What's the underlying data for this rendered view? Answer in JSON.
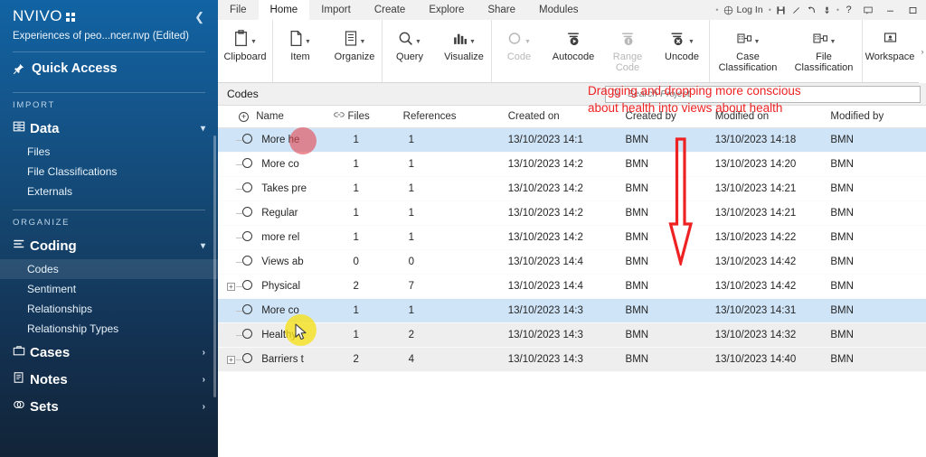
{
  "sidebar": {
    "logo": "NVIVO",
    "collapse_icon": "chevron-left-icon",
    "project_name": "Experiences of peo...ncer.nvp (Edited)",
    "quick_access": {
      "label": "Quick Access",
      "icon": "pin-icon"
    },
    "sections": [
      {
        "label": "IMPORT",
        "groups": [
          {
            "label": "Data",
            "icon": "data-icon",
            "chevron": "chevron-down-icon",
            "expanded": true,
            "items": [
              {
                "label": "Files",
                "active": false
              },
              {
                "label": "File Classifications",
                "active": false
              },
              {
                "label": "Externals",
                "active": false
              }
            ]
          }
        ]
      },
      {
        "label": "ORGANIZE",
        "groups": [
          {
            "label": "Coding",
            "icon": "coding-icon",
            "chevron": "chevron-down-icon",
            "expanded": true,
            "items": [
              {
                "label": "Codes",
                "active": true
              },
              {
                "label": "Sentiment",
                "active": false
              },
              {
                "label": "Relationships",
                "active": false
              },
              {
                "label": "Relationship Types",
                "active": false
              }
            ]
          },
          {
            "label": "Cases",
            "icon": "case-icon",
            "chevron": "chevron-right-icon",
            "expanded": false,
            "items": []
          },
          {
            "label": "Notes",
            "icon": "notes-icon",
            "chevron": "chevron-right-icon",
            "expanded": false,
            "items": []
          },
          {
            "label": "Sets",
            "icon": "sets-icon",
            "chevron": "chevron-right-icon",
            "expanded": false,
            "items": []
          }
        ]
      }
    ]
  },
  "tabbar": {
    "tabs": [
      {
        "label": "File",
        "active": false
      },
      {
        "label": "Home",
        "active": true
      },
      {
        "label": "Import",
        "active": false
      },
      {
        "label": "Create",
        "active": false
      },
      {
        "label": "Explore",
        "active": false
      },
      {
        "label": "Share",
        "active": false
      },
      {
        "label": "Modules",
        "active": false
      }
    ],
    "login_label": "Log In",
    "login_icon": "account-circle-icon",
    "quick_icons": [
      "save-icon",
      "pen-icon",
      "undo-icon",
      "redo-dropdown-icon",
      "dot-icon",
      "help-icon"
    ],
    "comment_icon": "comment-icon",
    "minimize_icon": "minimize-icon",
    "maximize_icon": "maximize-icon"
  },
  "ribbon": {
    "groups": [
      {
        "buttons": [
          {
            "label": "Clipboard",
            "icon": "clipboard-icon",
            "caret": true,
            "disabled": false
          }
        ]
      },
      {
        "buttons": [
          {
            "label": "Item",
            "icon": "item-icon",
            "caret": true,
            "disabled": false
          },
          {
            "label": "Organize",
            "icon": "organize-icon",
            "caret": true,
            "disabled": false
          }
        ]
      },
      {
        "buttons": [
          {
            "label": "Query",
            "icon": "query-icon",
            "caret": true,
            "disabled": false
          },
          {
            "label": "Visualize",
            "icon": "visualize-icon",
            "caret": true,
            "disabled": false
          }
        ]
      },
      {
        "buttons": [
          {
            "label": "Code",
            "icon": "code-icon",
            "caret": true,
            "disabled": true
          },
          {
            "label": "Autocode",
            "icon": "autocode-icon",
            "caret": false,
            "disabled": false
          },
          {
            "label": "Range Code",
            "icon": "range-code-icon",
            "caret": false,
            "disabled": true
          },
          {
            "label": "Uncode",
            "icon": "uncode-icon",
            "caret": true,
            "disabled": false
          }
        ]
      },
      {
        "buttons": [
          {
            "label": "Case Classification",
            "icon": "case-classification-icon",
            "caret": true,
            "disabled": false
          },
          {
            "label": "File Classification",
            "icon": "file-classification-icon",
            "caret": true,
            "disabled": false
          }
        ]
      },
      {
        "buttons": [
          {
            "label": "Workspace",
            "icon": "workspace-icon",
            "caret": false,
            "disabled": false
          }
        ]
      }
    ],
    "overflow_icon": "chevron-right-icon"
  },
  "codes_header": {
    "title": "Codes"
  },
  "search": {
    "placeholder": "Search Project",
    "value": "",
    "icon": "search-icon"
  },
  "annotation": {
    "text": "Dragging and dropping more conscious about health into views about health",
    "color": "#ee2222",
    "arrow_icon": "down-arrow-icon",
    "highlight_source_color": "#e24854",
    "highlight_target_color": "#f7e218",
    "cursor_icon": "mouse-pointer-icon"
  },
  "table": {
    "columns": [
      {
        "key": "name",
        "label": "Name",
        "icon": "circle-plus-icon"
      },
      {
        "key": "files",
        "label": "Files",
        "icon": "link-icon"
      },
      {
        "key": "references",
        "label": "References"
      },
      {
        "key": "created_on",
        "label": "Created on"
      },
      {
        "key": "created_by",
        "label": "Created by"
      },
      {
        "key": "modified_on",
        "label": "Modified on"
      },
      {
        "key": "modified_by",
        "label": "Modified by"
      }
    ],
    "rows": [
      {
        "expandable": false,
        "name": "More he",
        "files": "1",
        "references": "1",
        "created_on": "13/10/2023 14:1",
        "created_by": "BMN",
        "modified_on": "13/10/2023 14:18",
        "modified_by": "BMN",
        "selected": true,
        "alt": false
      },
      {
        "expandable": false,
        "name": "More co",
        "files": "1",
        "references": "1",
        "created_on": "13/10/2023 14:2",
        "created_by": "BMN",
        "modified_on": "13/10/2023 14:20",
        "modified_by": "BMN",
        "selected": false,
        "alt": false
      },
      {
        "expandable": false,
        "name": "Takes pre",
        "files": "1",
        "references": "1",
        "created_on": "13/10/2023 14:2",
        "created_by": "BMN",
        "modified_on": "13/10/2023 14:21",
        "modified_by": "BMN",
        "selected": false,
        "alt": false
      },
      {
        "expandable": false,
        "name": "Regular",
        "files": "1",
        "references": "1",
        "created_on": "13/10/2023 14:2",
        "created_by": "BMN",
        "modified_on": "13/10/2023 14:21",
        "modified_by": "BMN",
        "selected": false,
        "alt": false
      },
      {
        "expandable": false,
        "name": "more rel",
        "files": "1",
        "references": "1",
        "created_on": "13/10/2023 14:2",
        "created_by": "BMN",
        "modified_on": "13/10/2023 14:22",
        "modified_by": "BMN",
        "selected": false,
        "alt": false
      },
      {
        "expandable": false,
        "name": "Views ab",
        "files": "0",
        "references": "0",
        "created_on": "13/10/2023 14:4",
        "created_by": "BMN",
        "modified_on": "13/10/2023 14:42",
        "modified_by": "BMN",
        "selected": false,
        "alt": false
      },
      {
        "expandable": true,
        "name": "Physical",
        "files": "2",
        "references": "7",
        "created_on": "13/10/2023 14:4",
        "created_by": "BMN",
        "modified_on": "13/10/2023 14:42",
        "modified_by": "BMN",
        "selected": false,
        "alt": false
      },
      {
        "expandable": false,
        "name": "More co",
        "files": "1",
        "references": "1",
        "created_on": "13/10/2023 14:3",
        "created_by": "BMN",
        "modified_on": "13/10/2023 14:31",
        "modified_by": "BMN",
        "selected": true,
        "alt": false
      },
      {
        "expandable": false,
        "name": "Healthy",
        "files": "1",
        "references": "2",
        "created_on": "13/10/2023 14:3",
        "created_by": "BMN",
        "modified_on": "13/10/2023 14:32",
        "modified_by": "BMN",
        "selected": false,
        "alt": true
      },
      {
        "expandable": true,
        "name": "Barriers t",
        "files": "2",
        "references": "4",
        "created_on": "13/10/2023 14:3",
        "created_by": "BMN",
        "modified_on": "13/10/2023 14:40",
        "modified_by": "BMN",
        "selected": false,
        "alt": true
      }
    ]
  }
}
